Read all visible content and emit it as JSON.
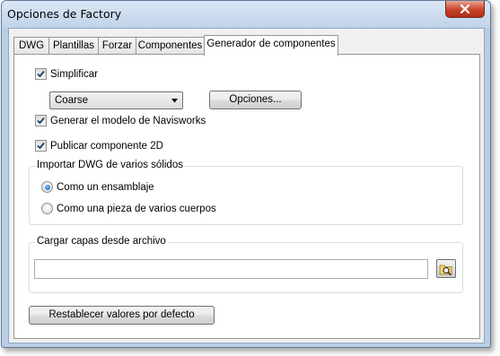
{
  "window": {
    "title": "Opciones de Factory"
  },
  "tabs": [
    {
      "label": "DWG",
      "active": false
    },
    {
      "label": "Plantillas",
      "active": false
    },
    {
      "label": "Forzar",
      "active": false
    },
    {
      "label": "Componentes",
      "active": false
    },
    {
      "label": "Generador de componentes",
      "active": true
    }
  ],
  "panel": {
    "simplificar": {
      "label": "Simplificar",
      "checked": true
    },
    "detail_select": {
      "value": "Coarse"
    },
    "opciones_button": "Opciones...",
    "generar_modelo": {
      "label": "Generar el modelo de Navisworks",
      "checked": true
    },
    "publicar": {
      "label": "Publicar componente 2D",
      "checked": true
    },
    "import_group": {
      "title": "Importar DWG de varios sólidos",
      "options": [
        {
          "label": "Como un ensamblaje",
          "selected": true
        },
        {
          "label": "Como una pieza de varios cuerpos",
          "selected": false
        }
      ]
    },
    "layers_group": {
      "title": "Cargar capas desde archivo",
      "path_value": ""
    },
    "reset_button": "Restablecer valores por defecto"
  },
  "colors": {
    "window_frame": "#b9cde5",
    "close_button": "#c7432a",
    "radio_selected": "#1a6fd0"
  },
  "icons": {
    "close": "close-icon",
    "dropdown": "chevron-down-icon",
    "browse": "folder-search-icon",
    "check": "checkmark-icon"
  }
}
